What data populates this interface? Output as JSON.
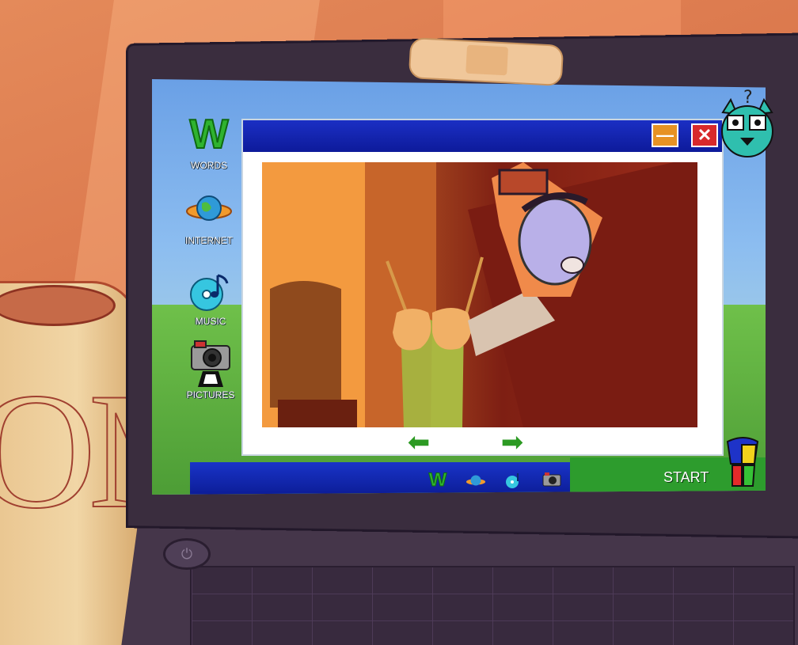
{
  "desktop": {
    "icons": [
      {
        "label": "WORDS",
        "icon": "words-w-icon"
      },
      {
        "label": "INTERNET",
        "icon": "internet-planet-icon"
      },
      {
        "label": "MUSIC",
        "icon": "music-disc-icon"
      },
      {
        "label": "PICTURES",
        "icon": "camera-icon"
      }
    ]
  },
  "window": {
    "minimize_glyph": "—",
    "close_glyph": "✕",
    "prev_arrow": "⬅",
    "next_arrow": "➡"
  },
  "taskbar": {
    "start_label": "START",
    "pinned": [
      "words-w-icon",
      "internet-planet-icon",
      "music-disc-icon",
      "camera-icon"
    ],
    "pinned_w": "W"
  },
  "power": {
    "glyph": "⏻"
  },
  "mug": {
    "text": "OM"
  },
  "colors": {
    "titlebar": "#1b2fc4",
    "taskbar": "#1934c8",
    "start": "#2d9c2d",
    "minimize": "#e79224",
    "close": "#d8292b"
  }
}
